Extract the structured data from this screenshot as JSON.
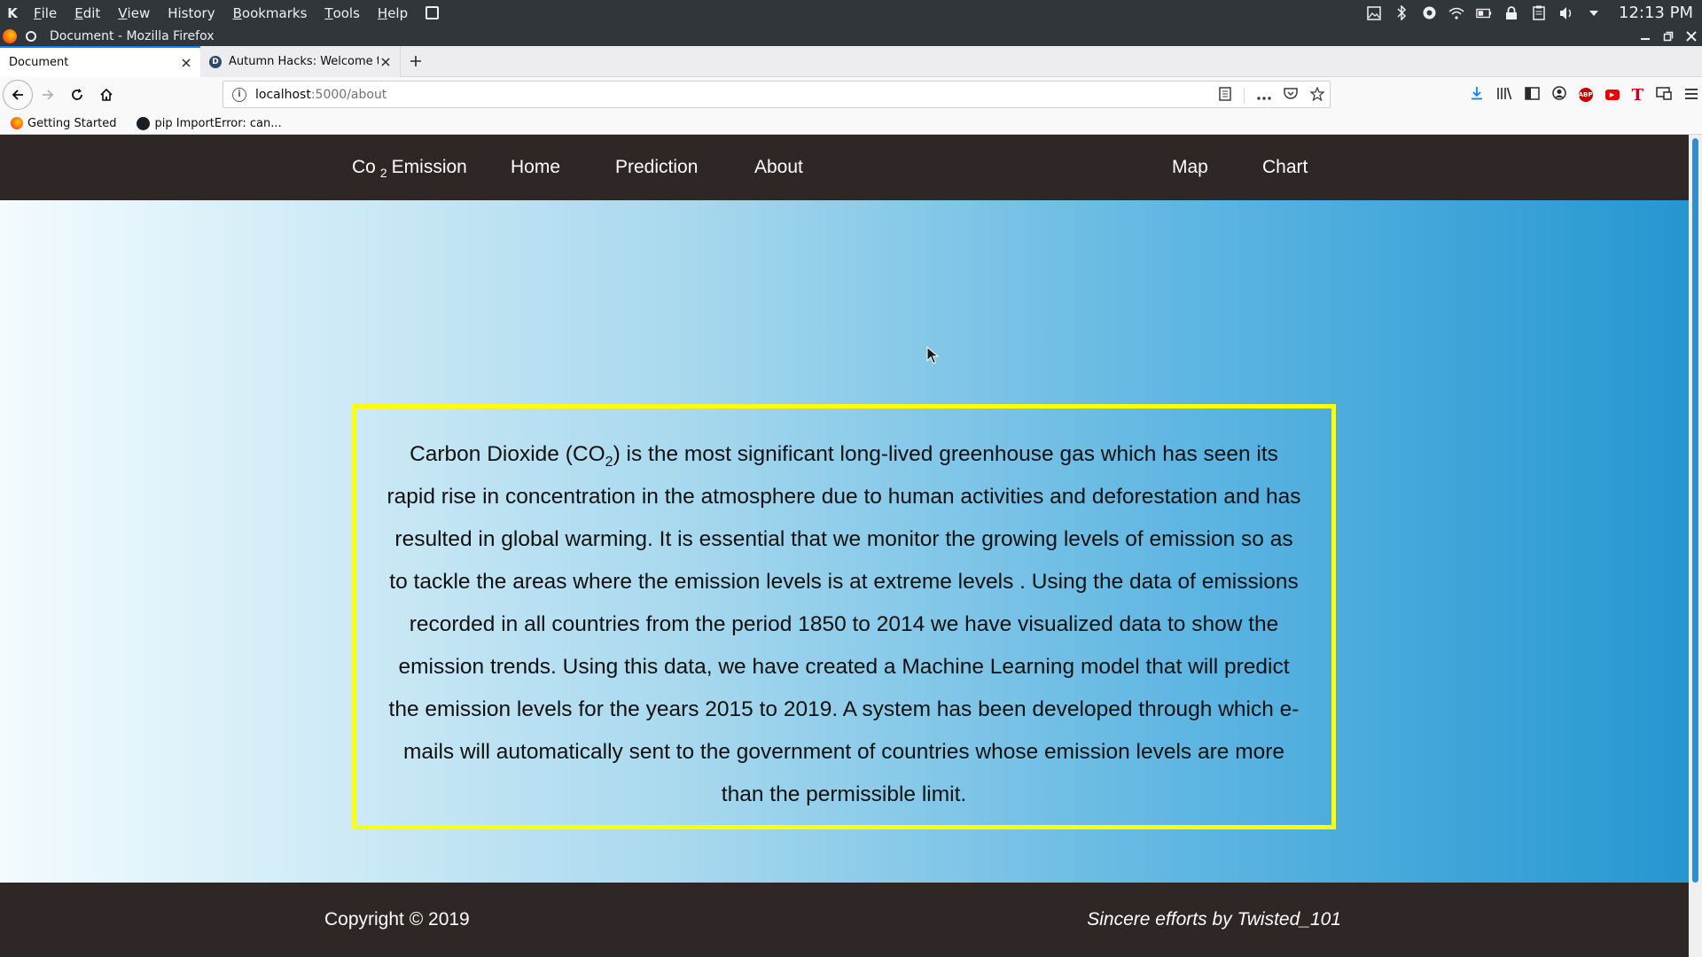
{
  "desktop": {
    "menu": [
      {
        "label": "File",
        "mnemonic": "F",
        "rest": "ile"
      },
      {
        "label": "Edit",
        "mnemonic": "E",
        "rest": "dit"
      },
      {
        "label": "View",
        "mnemonic": "V",
        "rest": "iew"
      },
      {
        "label": "History",
        "mnemonic": "",
        "rest": "History"
      },
      {
        "label": "Bookmarks",
        "mnemonic": "B",
        "rest": "ookmarks"
      },
      {
        "label": "Tools",
        "mnemonic": "T",
        "rest": "ools"
      },
      {
        "label": "Help",
        "mnemonic": "H",
        "rest": "elp"
      }
    ],
    "clock": "12:13 PM"
  },
  "window": {
    "title": "Document - Mozilla Firefox"
  },
  "tabs": [
    {
      "label": "Document",
      "active": true
    },
    {
      "label": "Autumn Hacks: Welcome t",
      "active": false
    }
  ],
  "url": {
    "host": "localhost",
    "path": ":5000/about"
  },
  "bookmarks": [
    {
      "label": "Getting Started"
    },
    {
      "label": "pip ImportError: can..."
    }
  ],
  "site": {
    "brand_prefix": "Co",
    "brand_sub": "2",
    "brand_suffix": "Emission",
    "nav_left": [
      "Home",
      "Prediction",
      "About"
    ],
    "nav_right": [
      "Map",
      "Chart"
    ],
    "about_part1": "Carbon Dioxide (CO",
    "about_sub": "2",
    "about_part2": ") is the most significant long-lived greenhouse gas which has seen its rapid rise in concentration in the atmosphere due to human activities and deforestation and has resulted in global warming. It is essential that we monitor the growing levels of emission so as to tackle the areas where the emission levels is at extreme levels . Using the data of emissions recorded in all countries from the period 1850 to 2014 we have visualized data to show the emission trends. Using this data, we have created a Machine Learning model that will predict the emission levels for the years 2015 to 2019. A system has been developed through which e-mails will automatically sent to the government of countries whose emission levels are more than the permissible limit.",
    "footer_copyright": "Copyright © 2019",
    "footer_credit": "Sincere efforts by Twisted_101"
  },
  "colors": {
    "nav_bg": "#2f2626",
    "box_border": "#ffff00",
    "accent": "#0a84ff"
  }
}
